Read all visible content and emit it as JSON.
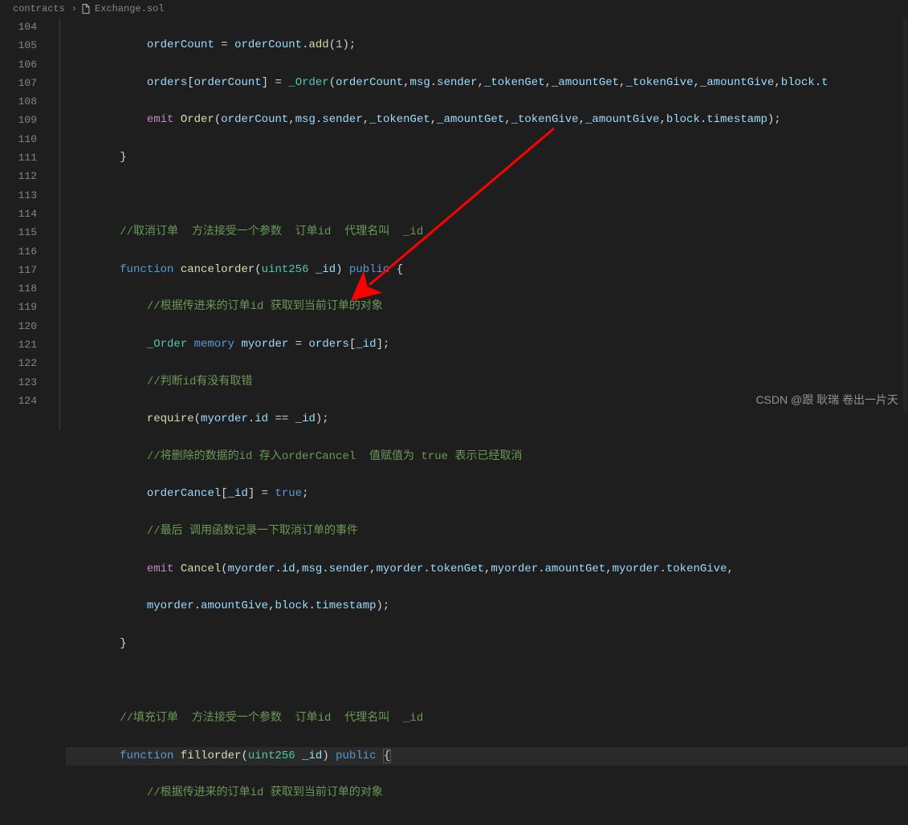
{
  "breadcrumb": {
    "folder": "contracts",
    "sep": "›",
    "file": "Exchange.sol"
  },
  "line_start": 104,
  "line_end": 124,
  "code": {
    "l104": {
      "indent": "            ",
      "var1": "orderCount",
      "op1": " = ",
      "var2": "orderCount",
      "dot": ".",
      "func": "add",
      "p1": "(",
      "num": "1",
      "p2": ");"
    },
    "l105": {
      "indent": "            ",
      "var1": "orders",
      "b1": "[",
      "var2": "orderCount",
      "b2": "]",
      "op": " = ",
      "type": "_Order",
      "p1": "(",
      "arg1": "orderCount",
      "c1": ",",
      "msg": "msg",
      "d1": ".",
      "sender": "sender",
      "c2": ",",
      "a2": "_tokenGet",
      "c3": ",",
      "a3": "_amountGet",
      "c4": ",",
      "a4": "_tokenGive",
      "c5": ",",
      "a5": "_amountGive",
      "c6": ",",
      "blk": "block",
      "d2": ".",
      "rest": "t"
    },
    "l106": {
      "indent": "            ",
      "kw": "emit",
      "sp": " ",
      "func": "Order",
      "p1": "(",
      "arg1": "orderCount",
      "c1": ",",
      "msg": "msg",
      "d1": ".",
      "sender": "sender",
      "c2": ",",
      "a2": "_tokenGet",
      "c3": ",",
      "a3": "_amountGet",
      "c4": ",",
      "a4": "_tokenGive",
      "c5": ",",
      "a5": "_amountGive",
      "c6": ",",
      "blk": "block",
      "d2": ".",
      "ts": "timestamp",
      "p2": ");"
    },
    "l107": {
      "indent": "        ",
      "brace": "}"
    },
    "l108": {
      "text": ""
    },
    "l109": {
      "indent": "        ",
      "comment": "//取消订单  方法接受一个参数  订单id  代理名叫  _id"
    },
    "l110": {
      "indent": "        ",
      "kw1": "function",
      "sp1": " ",
      "func": "cancelorder",
      "p1": "(",
      "type": "uint256",
      "sp2": " ",
      "arg": "_id",
      "p2": ")",
      "sp3": " ",
      "kw2": "public",
      "sp4": " ",
      "brace": "{"
    },
    "l111": {
      "indent": "            ",
      "comment": "//根据传进来的订单id 获取到当前订单的对象"
    },
    "l112": {
      "indent": "            ",
      "type": "_Order",
      "sp1": " ",
      "kw": "memory",
      "sp2": " ",
      "var1": "myorder",
      "op": " = ",
      "var2": "orders",
      "b1": "[",
      "arg": "_id",
      "b2": "];"
    },
    "l113": {
      "indent": "            ",
      "comment": "//判断id有没有取错"
    },
    "l114": {
      "indent": "            ",
      "func": "require",
      "p1": "(",
      "var1": "myorder",
      "d": ".",
      "prop": "id",
      "op": " == ",
      "arg": "_id",
      "p2": ");"
    },
    "l115": {
      "indent": "            ",
      "comment": "//将删除的数据的id 存入orderCancel  值赋值为 true 表示已经取消"
    },
    "l116": {
      "indent": "            ",
      "var1": "orderCancel",
      "b1": "[",
      "arg": "_id",
      "b2": "]",
      "op": " = ",
      "bool": "true",
      "p": ";"
    },
    "l117": {
      "indent": "            ",
      "comment": "//最后 调用函数记录一下取消订单的事件"
    },
    "l118": {
      "indent": "            ",
      "kw": "emit",
      "sp": " ",
      "func": "Cancel",
      "p1": "(",
      "v1": "myorder",
      "d1": ".",
      "p1a": "id",
      "c1": ",",
      "msg": "msg",
      "d2": ".",
      "sender": "sender",
      "c2": ",",
      "v2": "myorder",
      "d3": ".",
      "p2a": "tokenGet",
      "c3": ",",
      "v3": "myorder",
      "d4": ".",
      "p3a": "amountGet",
      "c4": ",",
      "v4": "myorder",
      "d5": ".",
      "p4a": "tokenGive",
      "c5": ","
    },
    "l119": {
      "indent": "            ",
      "v1": "myorder",
      "d1": ".",
      "p1a": "amountGive",
      "c1": ",",
      "blk": "block",
      "d2": ".",
      "ts": "timestamp",
      "p2": ");"
    },
    "l120": {
      "indent": "        ",
      "brace": "}"
    },
    "l121": {
      "text": ""
    },
    "l122": {
      "indent": "        ",
      "comment": "//填充订单  方法接受一个参数  订单id  代理名叫  _id"
    },
    "l123": {
      "indent": "        ",
      "kw1": "function",
      "sp1": " ",
      "func": "fillorder",
      "p1": "(",
      "type": "uint256",
      "sp2": " ",
      "arg": "_id",
      "p2": ")",
      "sp3": " ",
      "kw2": "public",
      "sp4": " ",
      "brace": "{"
    },
    "l124": {
      "indent": "            ",
      "comment": "//根据传进来的订单id 获取到当前订单的对象"
    }
  },
  "watermark": "CSDN @跟 耿瑞 卷出一片天"
}
